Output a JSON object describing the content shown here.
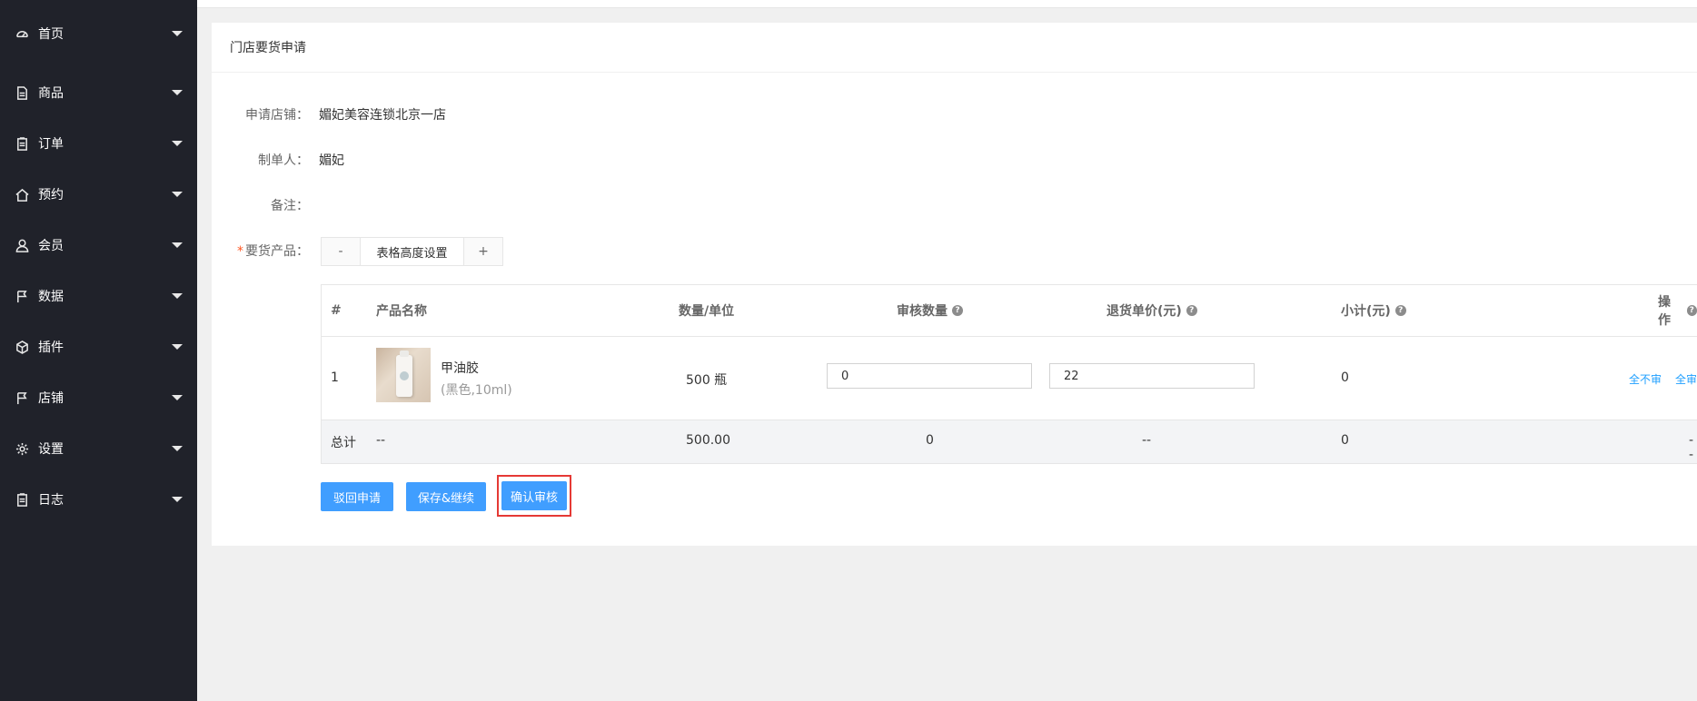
{
  "sidebar": {
    "items": [
      {
        "label": "首页",
        "icon": "dashboard-icon"
      },
      {
        "label": "商品",
        "icon": "document-icon"
      },
      {
        "label": "订单",
        "icon": "clipboard-icon"
      },
      {
        "label": "预约",
        "icon": "home-icon"
      },
      {
        "label": "会员",
        "icon": "user-icon"
      },
      {
        "label": "数据",
        "icon": "flag-icon"
      },
      {
        "label": "插件",
        "icon": "cube-icon"
      },
      {
        "label": "店铺",
        "icon": "flag-icon"
      },
      {
        "label": "设置",
        "icon": "gear-icon"
      },
      {
        "label": "日志",
        "icon": "clipboard-icon"
      }
    ]
  },
  "card": {
    "title": "门店要货申请"
  },
  "form": {
    "store_label": "申请店铺：",
    "store_value": "媚妃美容连锁北京一店",
    "maker_label": "制单人：",
    "maker_value": "媚妃",
    "remark_label": "备注：",
    "products_label": "要货产品：",
    "required_mark": "*"
  },
  "height_control": {
    "minus": "-",
    "label": "表格高度设置",
    "plus": "+"
  },
  "table": {
    "headers": {
      "index": "#",
      "name": "产品名称",
      "qty_unit": "数量/单位",
      "audit_qty": "审核数量",
      "return_price": "退货单价(元)",
      "subtotal": "小计(元)",
      "action": "操作"
    },
    "help_glyph": "?",
    "rows": [
      {
        "index": "1",
        "name": "甲油胶",
        "spec": "(黑色,10ml)",
        "qty_unit": "500 瓶",
        "audit_qty": "0",
        "return_price": "22",
        "subtotal": "0",
        "action_none": "全不审",
        "action_all": "全审"
      }
    ],
    "total": {
      "label": "总计",
      "name": "--",
      "qty": "500.00",
      "audit_qty": "0",
      "return_price": "--",
      "subtotal": "0",
      "action": "--"
    }
  },
  "buttons": {
    "reject": "驳回申请",
    "save_continue": "保存&继续",
    "confirm": "确认审核"
  },
  "colors": {
    "sidebar_bg": "#20222a",
    "primary": "#409eff",
    "link": "#1e9fff",
    "highlight": "#e53935"
  }
}
